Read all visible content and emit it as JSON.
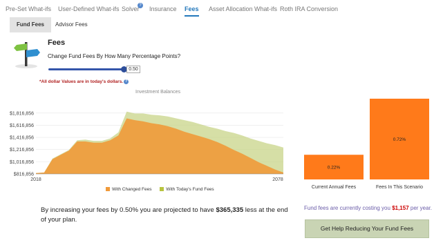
{
  "nav": {
    "tabs": [
      "Pre-Set What-ifs",
      "User-Defined What-ifs",
      "Solver",
      "Insurance",
      "Fees",
      "Asset Allocation What-ifs",
      "Roth IRA Conversion"
    ],
    "active": "Fees",
    "solver_help": "?"
  },
  "subtabs": [
    "Fund Fees",
    "Advisor Fees"
  ],
  "fees": {
    "title": "Fees",
    "question": "Change Fund Fees By How Many Percentage Points?",
    "slider_value": "0.50",
    "slider_fraction": 0.5,
    "note": "*All dollar Values are in today's dollars.",
    "note_icon": "?"
  },
  "colors": {
    "changed": "#f09a3a",
    "todays": "#c8d488",
    "bar": "#ff7a1a",
    "accent": "#2277bb"
  },
  "chart_data": [
    {
      "type": "area",
      "title": "Investment Balances",
      "x": [
        2018,
        2020,
        2022,
        2024,
        2026,
        2028,
        2030,
        2032,
        2034,
        2036,
        2038,
        2040,
        2042,
        2044,
        2046,
        2048,
        2050,
        2052,
        2054,
        2056,
        2058,
        2060,
        2062,
        2064,
        2066,
        2068,
        2070,
        2072,
        2074,
        2076,
        2078
      ],
      "series": [
        {
          "name": "With Changed Fees",
          "values": [
            830000,
            840000,
            1060000,
            1130000,
            1200000,
            1350000,
            1350000,
            1330000,
            1330000,
            1370000,
            1450000,
            1730000,
            1700000,
            1680000,
            1650000,
            1630000,
            1600000,
            1560000,
            1510000,
            1470000,
            1430000,
            1390000,
            1340000,
            1280000,
            1210000,
            1150000,
            1080000,
            1010000,
            950000,
            890000,
            840000
          ]
        },
        {
          "name": "With Today's Fund Fees",
          "values": [
            830000,
            840000,
            1070000,
            1140000,
            1210000,
            1370000,
            1380000,
            1360000,
            1360000,
            1400000,
            1500000,
            1840000,
            1810000,
            1810000,
            1790000,
            1780000,
            1760000,
            1730000,
            1700000,
            1670000,
            1630000,
            1590000,
            1560000,
            1520000,
            1490000,
            1450000,
            1400000,
            1360000,
            1320000,
            1290000,
            1250000
          ]
        }
      ],
      "y_ticks": [
        "$816,856",
        "$1,016,856",
        "$1,216,856",
        "$1,416,856",
        "$1,616,856",
        "$1,816,856"
      ],
      "x_ticks": [
        "2018",
        "2078"
      ],
      "ylim": [
        816856,
        1916856
      ],
      "grid": true,
      "legend": "bottom"
    },
    {
      "type": "bar",
      "categories": [
        "Current Annual Fees",
        "Fees In This Scenario"
      ],
      "values": [
        0.22,
        0.72
      ],
      "labels": [
        "0.22%",
        "0.72%"
      ],
      "ylim": [
        0,
        0.8
      ]
    }
  ],
  "summary": {
    "pre": "By increasing your fees by 0.50% you are projected to have",
    "amount": "$365,335",
    "post": "less at the end of your plan."
  },
  "cost": {
    "pre": "Fund fees are currently costing you",
    "amount": "$1,157",
    "post": "per year."
  },
  "help_button": "Get Help Reducing Your Fund Fees"
}
